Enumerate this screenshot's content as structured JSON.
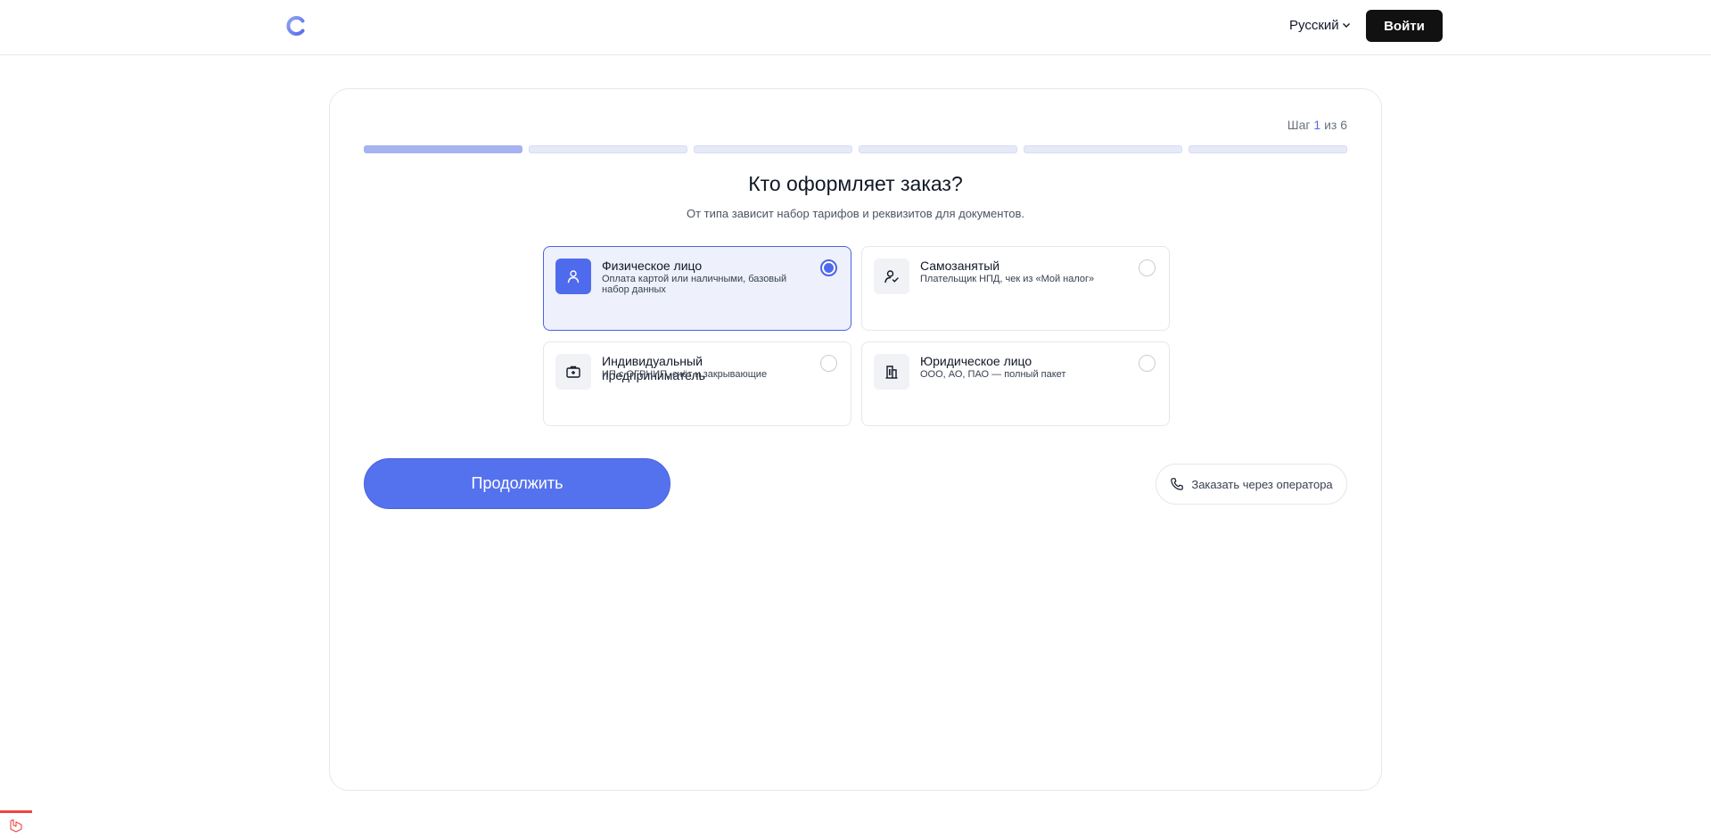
{
  "header": {
    "logo_icon": "logo-c-icon",
    "language_label": "Русский",
    "language_icon": "chevron-down-icon",
    "login_label": "Войти"
  },
  "wizard": {
    "step_prefix": "Шаг",
    "step_current": "1",
    "step_separator": "из",
    "step_total": "6",
    "progress_fraction": 0.1667,
    "title": "Кто оформляет заказ?",
    "subtitle": "От типа зависит набор тарифов и реквизитов для документов.",
    "options": [
      {
        "title": "Физическое лицо",
        "desc": "Оплата картой или наличными, базовый набор данных",
        "icon": "user-icon",
        "selected": true
      },
      {
        "title": "Самозанятый",
        "desc": "Плательщик НПД, чек из «Мой налог»",
        "icon": "user-check-icon",
        "selected": false
      },
      {
        "title": "Индивидуальный предприниматель",
        "desc": "ИП с ОГРНИП, счёт и закрывающие",
        "icon": "briefcase-plus-icon",
        "selected": false
      },
      {
        "title": "Юридическое лицо",
        "desc": "ООО, АО, ПАО — полный пакет",
        "icon": "building-icon",
        "selected": false
      }
    ],
    "continue_label": "Продолжить",
    "operator_label": "Заказать через оператора",
    "operator_icon": "phone-icon"
  },
  "colors": {
    "accent": "#4f6bed",
    "accent_button": "#5572ee",
    "selected_bg": "#eef0fb",
    "progress_active": "#a5b3ef",
    "progress_inactive": "#e6e9f8",
    "login_bg": "#111111"
  }
}
